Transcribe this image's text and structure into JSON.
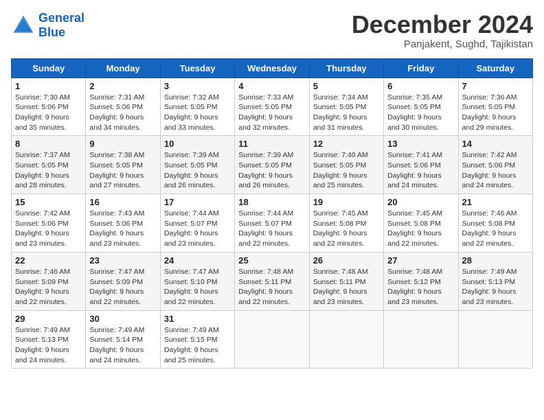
{
  "header": {
    "logo_line1": "General",
    "logo_line2": "Blue",
    "month_title": "December 2024",
    "subtitle": "Panjakent, Sughd, Tajikistan"
  },
  "weekdays": [
    "Sunday",
    "Monday",
    "Tuesday",
    "Wednesday",
    "Thursday",
    "Friday",
    "Saturday"
  ],
  "weeks": [
    [
      {
        "day": 1,
        "sunrise": "7:30 AM",
        "sunset": "5:06 PM",
        "daylight": "9 hours and 35 minutes."
      },
      {
        "day": 2,
        "sunrise": "7:31 AM",
        "sunset": "5:06 PM",
        "daylight": "9 hours and 34 minutes."
      },
      {
        "day": 3,
        "sunrise": "7:32 AM",
        "sunset": "5:05 PM",
        "daylight": "9 hours and 33 minutes."
      },
      {
        "day": 4,
        "sunrise": "7:33 AM",
        "sunset": "5:05 PM",
        "daylight": "9 hours and 32 minutes."
      },
      {
        "day": 5,
        "sunrise": "7:34 AM",
        "sunset": "5:05 PM",
        "daylight": "9 hours and 31 minutes."
      },
      {
        "day": 6,
        "sunrise": "7:35 AM",
        "sunset": "5:05 PM",
        "daylight": "9 hours and 30 minutes."
      },
      {
        "day": 7,
        "sunrise": "7:36 AM",
        "sunset": "5:05 PM",
        "daylight": "9 hours and 29 minutes."
      }
    ],
    [
      {
        "day": 8,
        "sunrise": "7:37 AM",
        "sunset": "5:05 PM",
        "daylight": "9 hours and 28 minutes."
      },
      {
        "day": 9,
        "sunrise": "7:38 AM",
        "sunset": "5:05 PM",
        "daylight": "9 hours and 27 minutes."
      },
      {
        "day": 10,
        "sunrise": "7:39 AM",
        "sunset": "5:05 PM",
        "daylight": "9 hours and 26 minutes."
      },
      {
        "day": 11,
        "sunrise": "7:39 AM",
        "sunset": "5:05 PM",
        "daylight": "9 hours and 26 minutes."
      },
      {
        "day": 12,
        "sunrise": "7:40 AM",
        "sunset": "5:05 PM",
        "daylight": "9 hours and 25 minutes."
      },
      {
        "day": 13,
        "sunrise": "7:41 AM",
        "sunset": "5:06 PM",
        "daylight": "9 hours and 24 minutes."
      },
      {
        "day": 14,
        "sunrise": "7:42 AM",
        "sunset": "5:06 PM",
        "daylight": "9 hours and 24 minutes."
      }
    ],
    [
      {
        "day": 15,
        "sunrise": "7:42 AM",
        "sunset": "5:06 PM",
        "daylight": "9 hours and 23 minutes."
      },
      {
        "day": 16,
        "sunrise": "7:43 AM",
        "sunset": "5:06 PM",
        "daylight": "9 hours and 23 minutes."
      },
      {
        "day": 17,
        "sunrise": "7:44 AM",
        "sunset": "5:07 PM",
        "daylight": "9 hours and 23 minutes."
      },
      {
        "day": 18,
        "sunrise": "7:44 AM",
        "sunset": "5:07 PM",
        "daylight": "9 hours and 22 minutes."
      },
      {
        "day": 19,
        "sunrise": "7:45 AM",
        "sunset": "5:08 PM",
        "daylight": "9 hours and 22 minutes."
      },
      {
        "day": 20,
        "sunrise": "7:45 AM",
        "sunset": "5:08 PM",
        "daylight": "9 hours and 22 minutes."
      },
      {
        "day": 21,
        "sunrise": "7:46 AM",
        "sunset": "5:08 PM",
        "daylight": "9 hours and 22 minutes."
      }
    ],
    [
      {
        "day": 22,
        "sunrise": "7:46 AM",
        "sunset": "5:09 PM",
        "daylight": "9 hours and 22 minutes."
      },
      {
        "day": 23,
        "sunrise": "7:47 AM",
        "sunset": "5:09 PM",
        "daylight": "9 hours and 22 minutes."
      },
      {
        "day": 24,
        "sunrise": "7:47 AM",
        "sunset": "5:10 PM",
        "daylight": "9 hours and 22 minutes."
      },
      {
        "day": 25,
        "sunrise": "7:48 AM",
        "sunset": "5:11 PM",
        "daylight": "9 hours and 22 minutes."
      },
      {
        "day": 26,
        "sunrise": "7:48 AM",
        "sunset": "5:11 PM",
        "daylight": "9 hours and 23 minutes."
      },
      {
        "day": 27,
        "sunrise": "7:48 AM",
        "sunset": "5:12 PM",
        "daylight": "9 hours and 23 minutes."
      },
      {
        "day": 28,
        "sunrise": "7:49 AM",
        "sunset": "5:13 PM",
        "daylight": "9 hours and 23 minutes."
      }
    ],
    [
      {
        "day": 29,
        "sunrise": "7:49 AM",
        "sunset": "5:13 PM",
        "daylight": "9 hours and 24 minutes."
      },
      {
        "day": 30,
        "sunrise": "7:49 AM",
        "sunset": "5:14 PM",
        "daylight": "9 hours and 24 minutes."
      },
      {
        "day": 31,
        "sunrise": "7:49 AM",
        "sunset": "5:15 PM",
        "daylight": "9 hours and 25 minutes."
      },
      null,
      null,
      null,
      null
    ]
  ]
}
